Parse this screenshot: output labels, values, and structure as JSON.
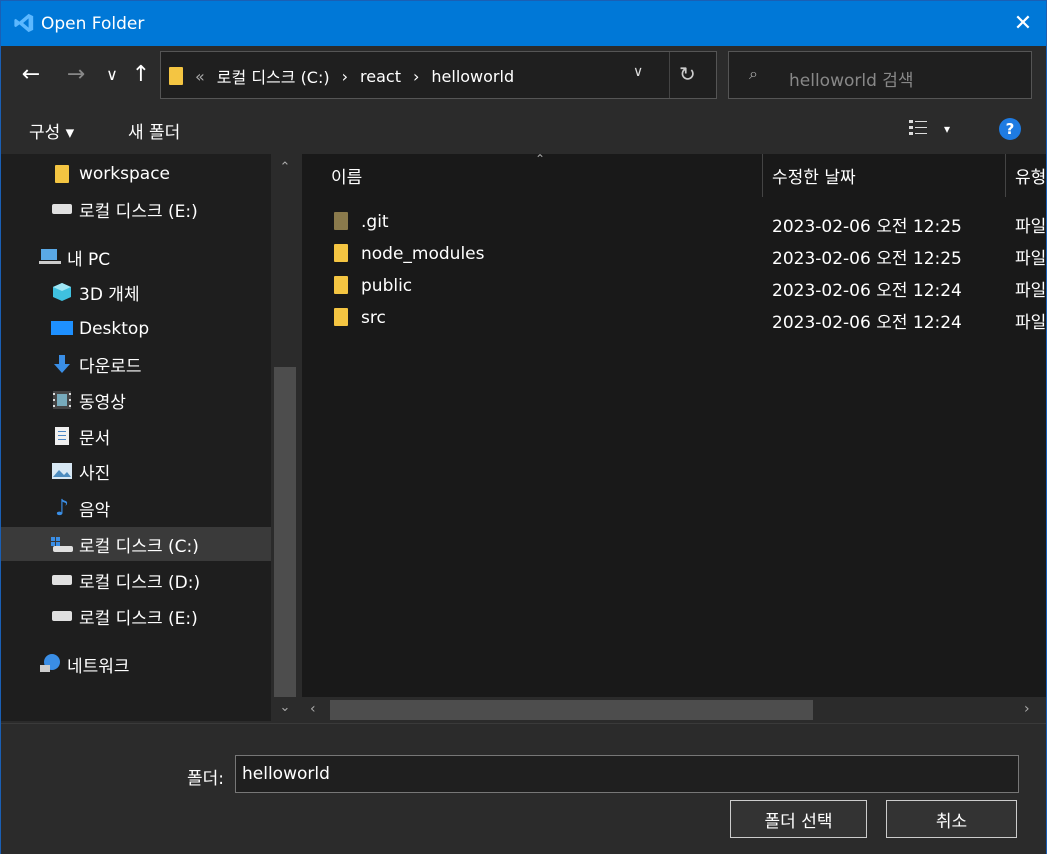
{
  "window": {
    "title": "Open Folder",
    "close_glyph": "✕"
  },
  "nav_buttons": {
    "back": "←",
    "forward": "→",
    "recent": "∨",
    "up": "↑"
  },
  "address": {
    "chevron": "«",
    "crumbs": [
      "로컬 디스크 (C:)",
      "react",
      "helloworld"
    ],
    "separator": "›",
    "dropdown": "∨",
    "refresh": "↻"
  },
  "search": {
    "icon": "⌕",
    "placeholder": "helloworld 검색"
  },
  "commands": {
    "organize": "구성 ▾",
    "new_folder": "새 폴더",
    "view_arrow": "▾",
    "help": "?"
  },
  "sidebar": {
    "items": [
      {
        "label": "workspace",
        "icon": "folder-icon"
      },
      {
        "label": "로컬 디스크 (E:)",
        "icon": "drive-icon"
      },
      {
        "label": "내 PC",
        "icon": "pc-icon"
      },
      {
        "label": "3D 개체",
        "icon": "3d-objects-icon"
      },
      {
        "label": "Desktop",
        "icon": "desktop-icon"
      },
      {
        "label": "다운로드",
        "icon": "download-icon"
      },
      {
        "label": "동영상",
        "icon": "video-icon"
      },
      {
        "label": "문서",
        "icon": "document-icon"
      },
      {
        "label": "사진",
        "icon": "picture-icon"
      },
      {
        "label": "음악",
        "icon": "music-icon"
      },
      {
        "label": "로컬 디스크 (C:)",
        "icon": "windows-drive-icon",
        "selected": true
      },
      {
        "label": "로컬 디스크 (D:)",
        "icon": "drive-icon"
      },
      {
        "label": "로컬 디스크 (E:)",
        "icon": "drive-icon"
      },
      {
        "label": "네트워크",
        "icon": "network-icon"
      }
    ]
  },
  "file_list": {
    "columns": [
      "이름",
      "수정한 날짜",
      "유형"
    ],
    "rows": [
      {
        "name": ".git",
        "modified": "2023-02-06 오전 12:25",
        "type": "파일"
      },
      {
        "name": "node_modules",
        "modified": "2023-02-06 오전 12:25",
        "type": "파일"
      },
      {
        "name": "public",
        "modified": "2023-02-06 오전 12:24",
        "type": "파일"
      },
      {
        "name": "src",
        "modified": "2023-02-06 오전 12:24",
        "type": "파일"
      }
    ]
  },
  "footer": {
    "folder_label": "폴더:",
    "folder_value": "helloworld",
    "select_button": "폴더 선택",
    "cancel_button": "취소"
  },
  "colors": {
    "titlebar": "#0078d7",
    "folder": "#f4c542",
    "help": "#1e7be2"
  }
}
